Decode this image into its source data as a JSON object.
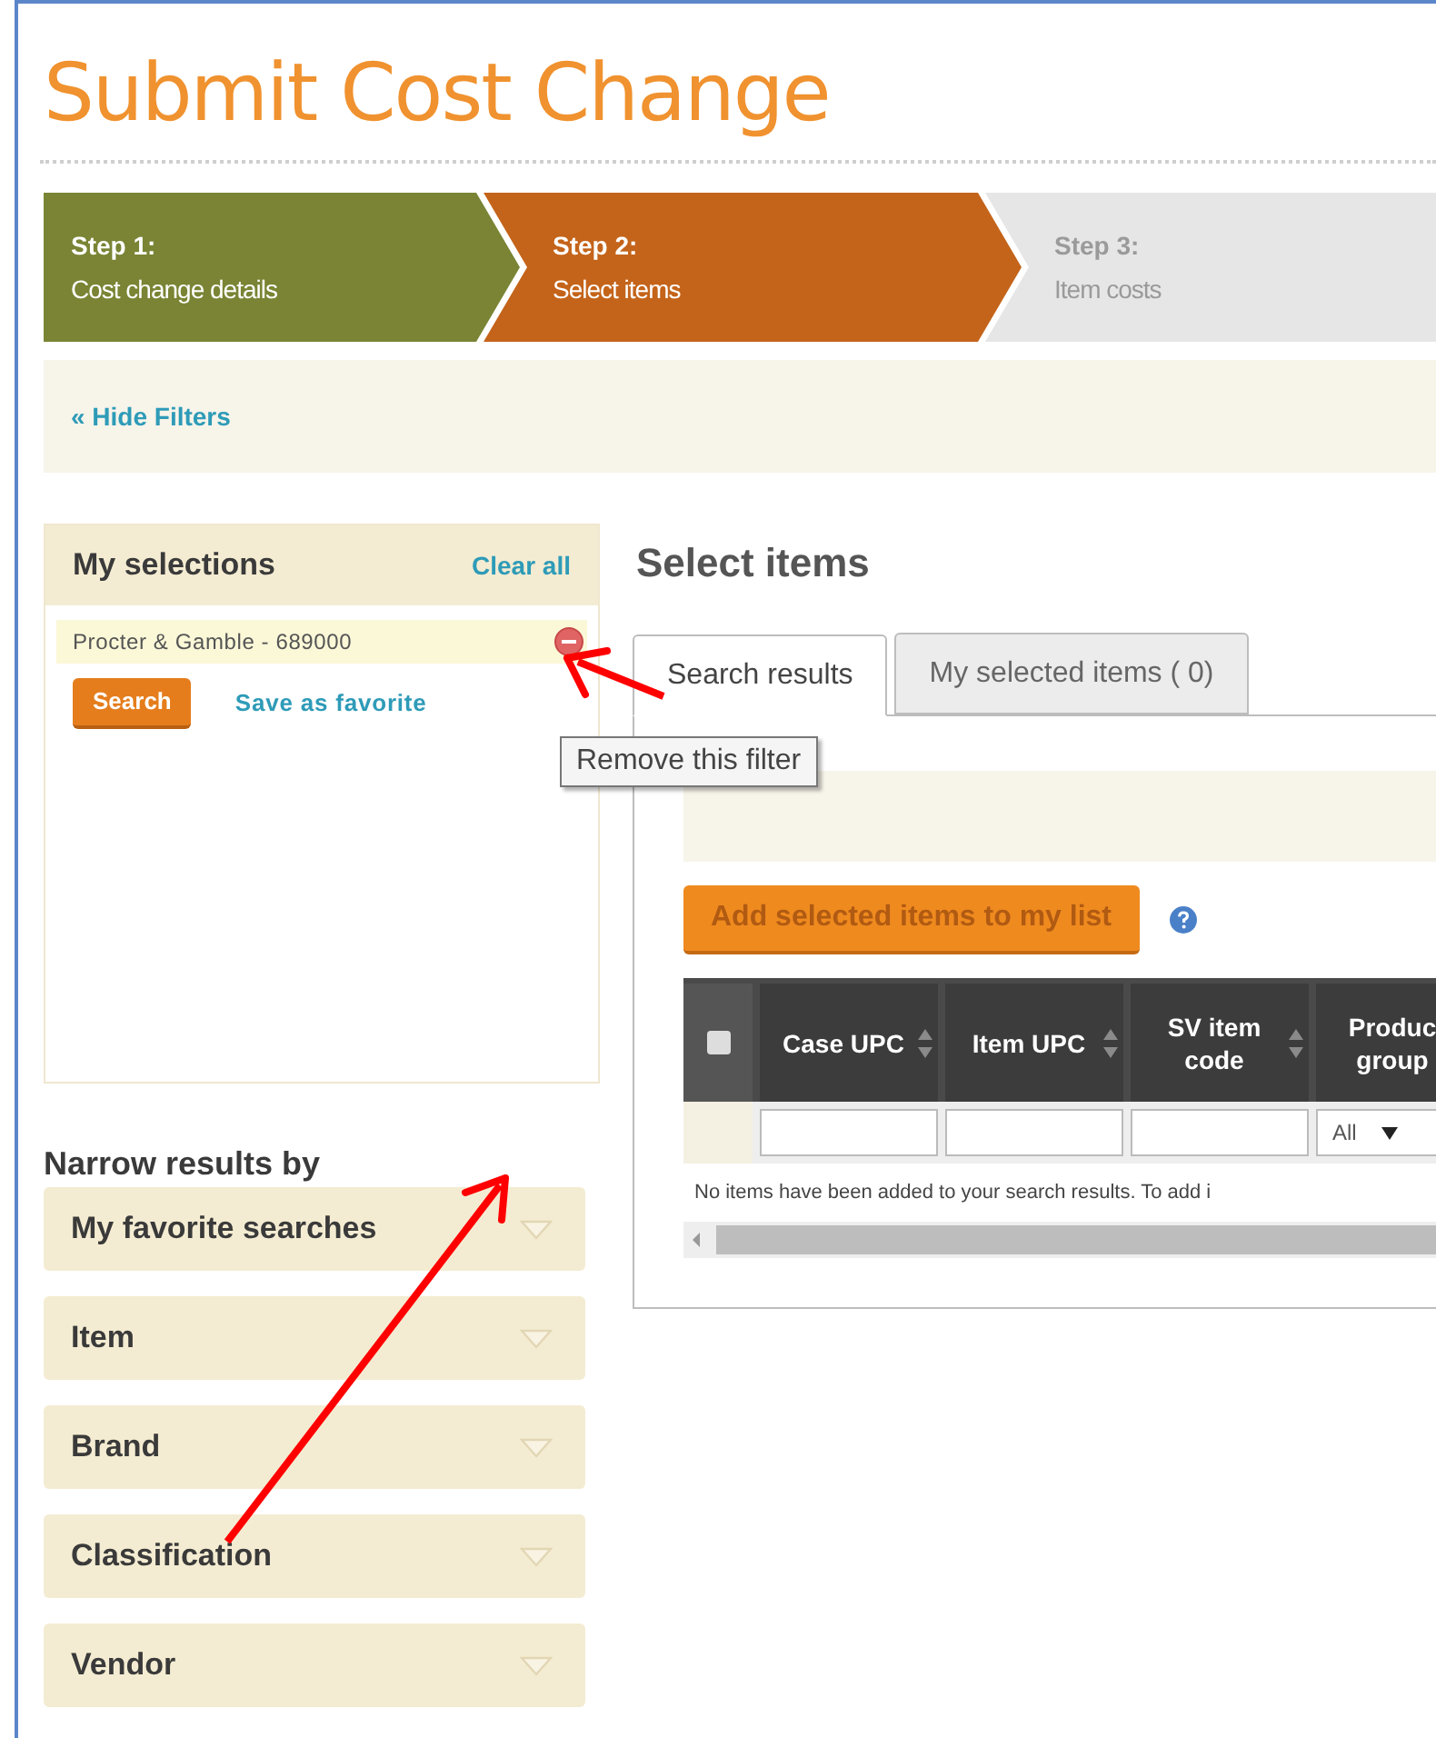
{
  "page_title": "Submit Cost Change",
  "steps": [
    {
      "label": "Step 1:",
      "name": "Cost change details",
      "kind": "done"
    },
    {
      "label": "Step 2:",
      "name": "Select items",
      "kind": "current"
    },
    {
      "label": "Step 3:",
      "name": "Item costs",
      "kind": "upcoming"
    }
  ],
  "filter_toggle": "« Hide Filters",
  "my_selections": {
    "title": "My selections",
    "clear_all": "Clear all",
    "filters": [
      {
        "label": "Procter & Gamble - 689000"
      }
    ],
    "search_button": "Search",
    "save_favorite": "Save as favorite",
    "tooltip": "Remove this filter"
  },
  "narrow_results": {
    "title": "Narrow results by",
    "sections": [
      {
        "label": "My favorite searches"
      },
      {
        "label": "Item"
      },
      {
        "label": "Brand"
      },
      {
        "label": "Classification"
      },
      {
        "label": "Vendor"
      }
    ]
  },
  "select_items": {
    "title": "Select items",
    "tabs": [
      {
        "label": "Search results",
        "selected": true
      },
      {
        "label": "My selected items ( 0)",
        "selected": false
      }
    ],
    "add_button": "Add selected items to my list",
    "table": {
      "select_all": {
        "checked": false
      },
      "columns": [
        {
          "label": "Case UPC",
          "kind": "text"
        },
        {
          "label": "Item UPC",
          "kind": "text"
        },
        {
          "label": "SV item code",
          "kind": "text"
        },
        {
          "label": "Produc group",
          "kind": "select",
          "filter_value": "All"
        }
      ],
      "empty_message": "No items have been added to your search results. To add i"
    }
  },
  "annotations": [
    {
      "kind": "arrow"
    },
    {
      "kind": "arrow"
    }
  ]
}
